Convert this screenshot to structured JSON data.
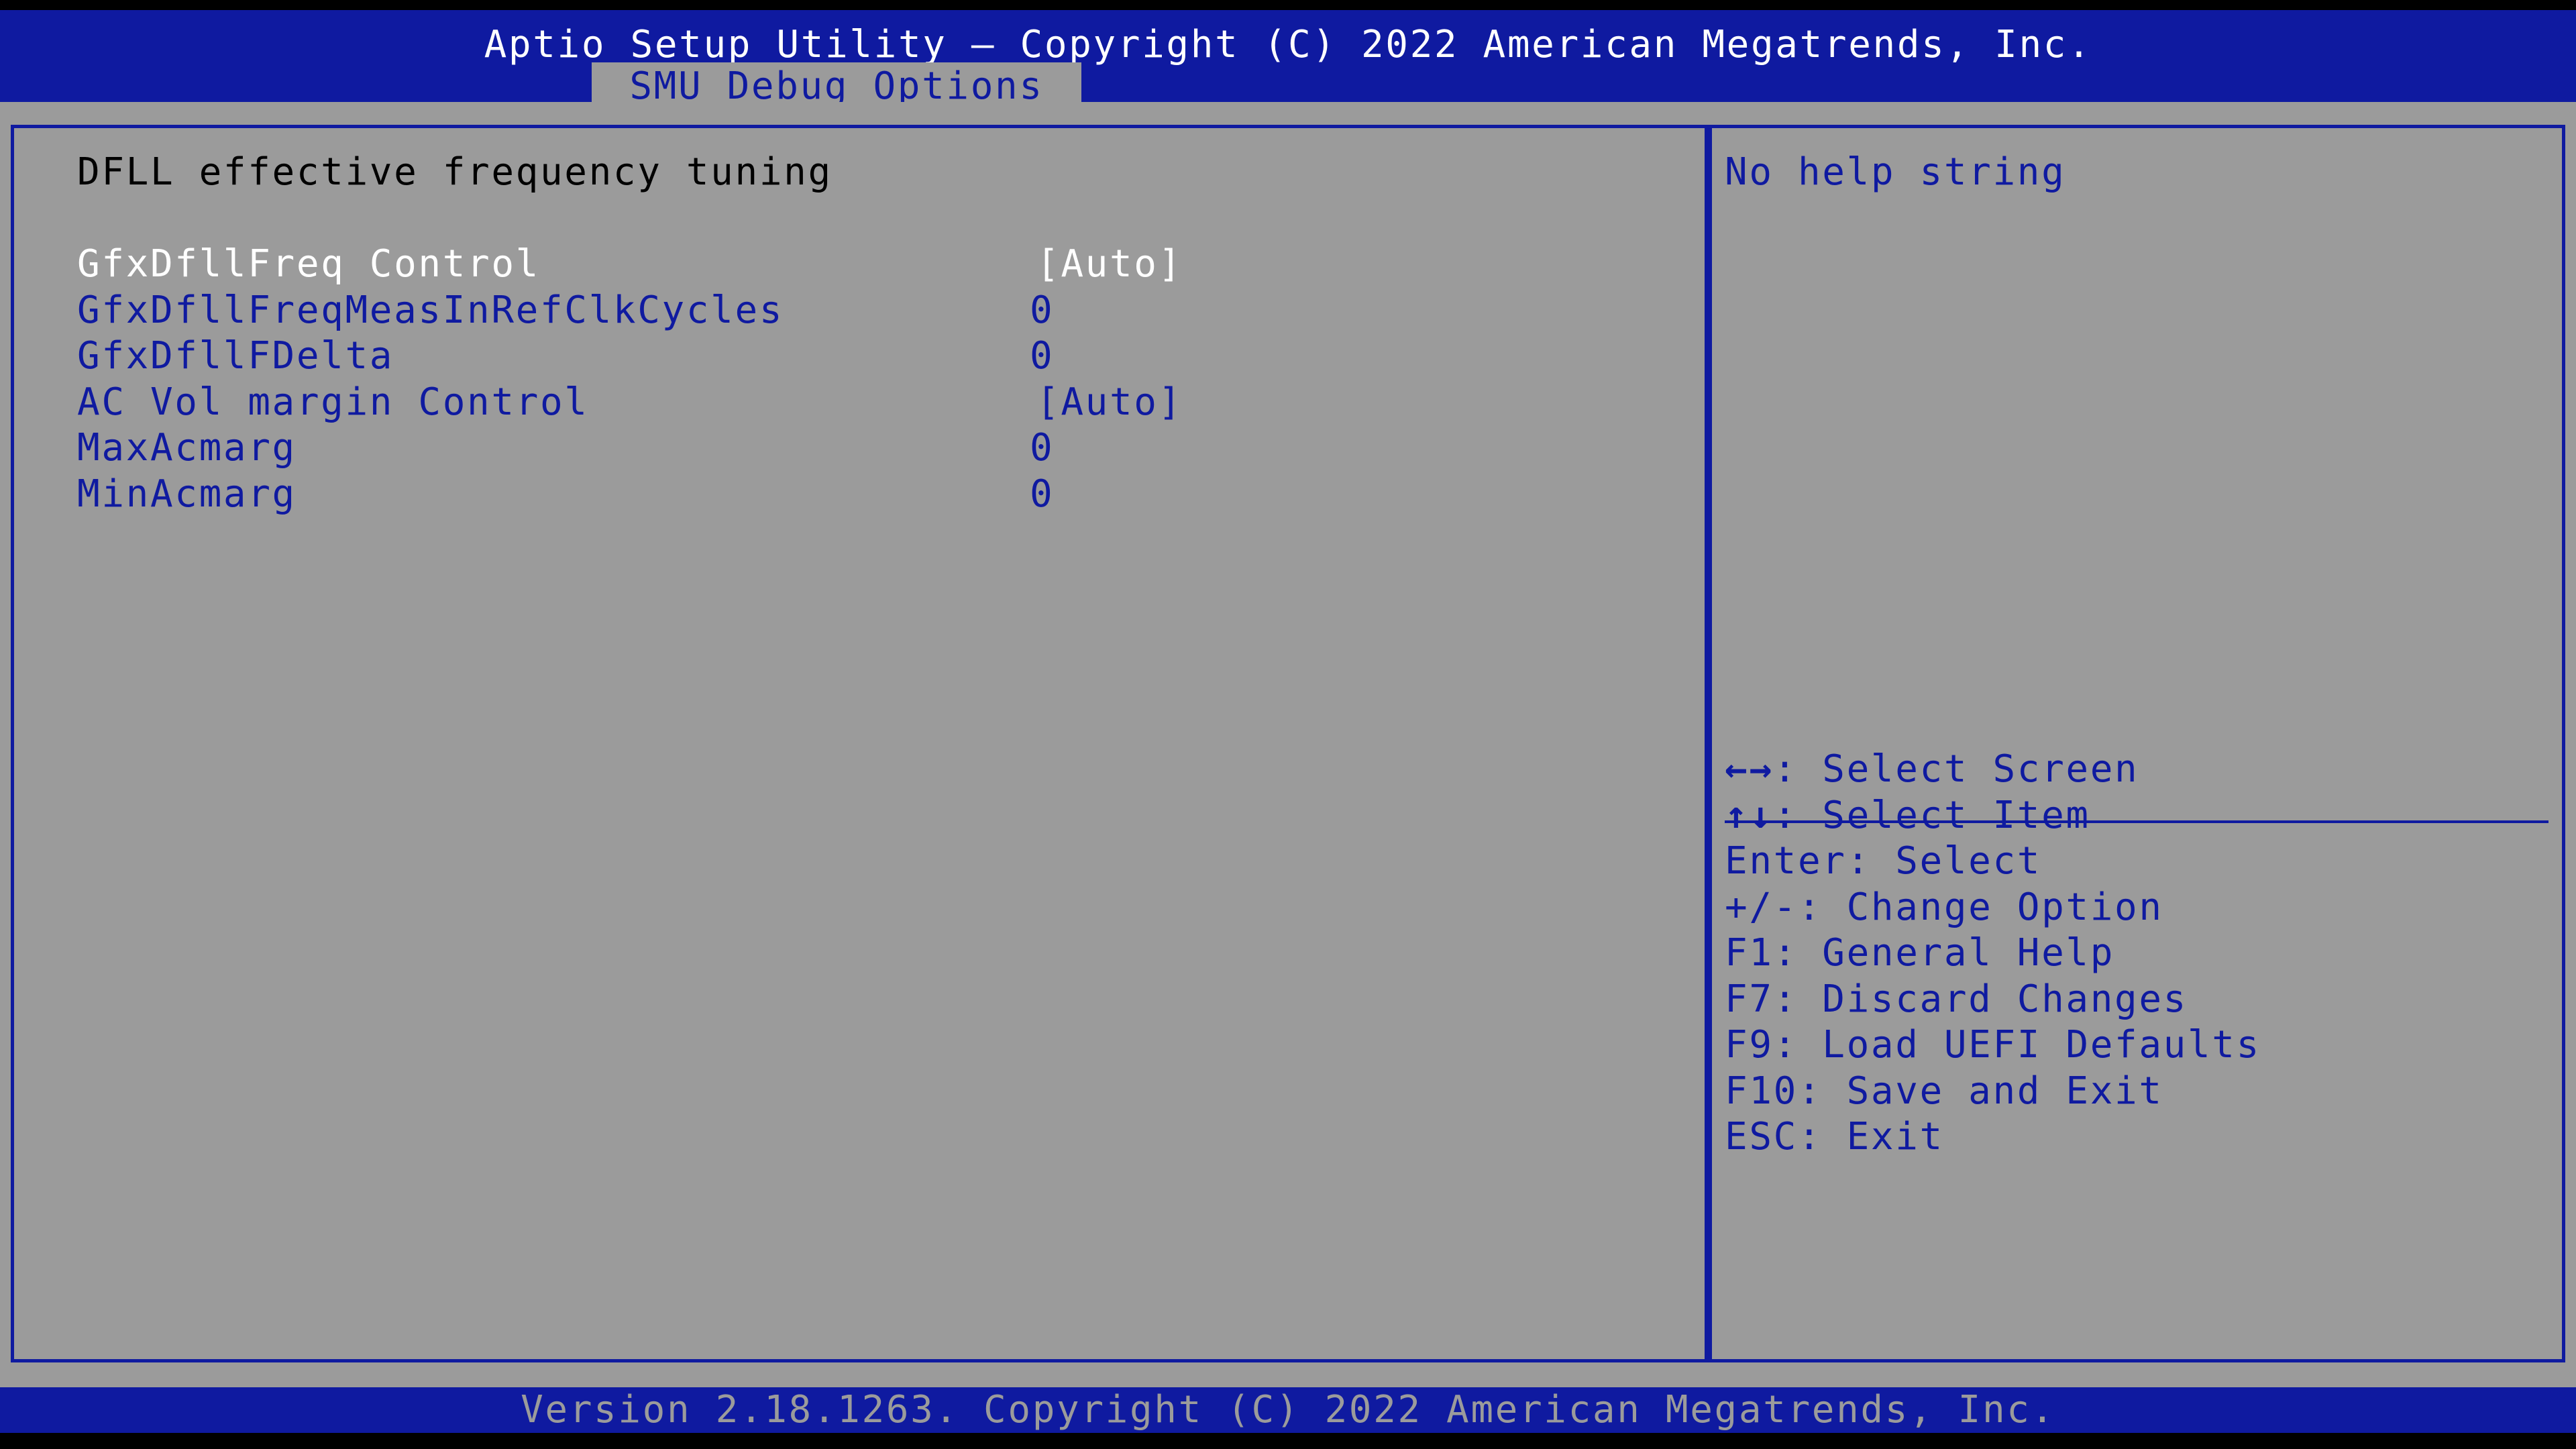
{
  "header": {
    "title": "Aptio Setup Utility – Copyright (C) 2022 American Megatrends, Inc.",
    "active_tab": "SMU Debug Options"
  },
  "main": {
    "section_heading": "DFLL effective frequency tuning",
    "items": [
      {
        "label": "GfxDfllFreq Control",
        "value": "[Auto]",
        "selected": true
      },
      {
        "label": "GfxDfllFreqMeasInRefClkCycles",
        "value": "0",
        "selected": false
      },
      {
        "label": "GfxDfllFDelta",
        "value": "0",
        "selected": false
      },
      {
        "label": "AC Vol margin Control",
        "value": "[Auto]",
        "selected": false
      },
      {
        "label": "MaxAcmarg",
        "value": "0",
        "selected": false
      },
      {
        "label": "MinAcmarg",
        "value": "0",
        "selected": false
      }
    ]
  },
  "help": {
    "text": "No help string",
    "keys": [
      {
        "key": "←→",
        "desc": ": Select Screen"
      },
      {
        "key": "↑↓",
        "desc": ": Select Item"
      },
      {
        "key": "Enter",
        "desc": ": Select"
      },
      {
        "key": "+/-",
        "desc": ": Change Option"
      },
      {
        "key": "F1",
        "desc": ": General Help"
      },
      {
        "key": "F7",
        "desc": ": Discard Changes"
      },
      {
        "key": "F9",
        "desc": ": Load UEFI Defaults"
      },
      {
        "key": "F10",
        "desc": ": Save and Exit"
      },
      {
        "key": "ESC",
        "desc": ": Exit"
      }
    ]
  },
  "footer": {
    "version": "Version 2.18.1263. Copyright (C) 2022 American Megatrends, Inc."
  },
  "colors": {
    "bios_blue": "#0f1aa0",
    "panel_gray": "#9b9b9b",
    "selected_text": "#ffffff"
  }
}
